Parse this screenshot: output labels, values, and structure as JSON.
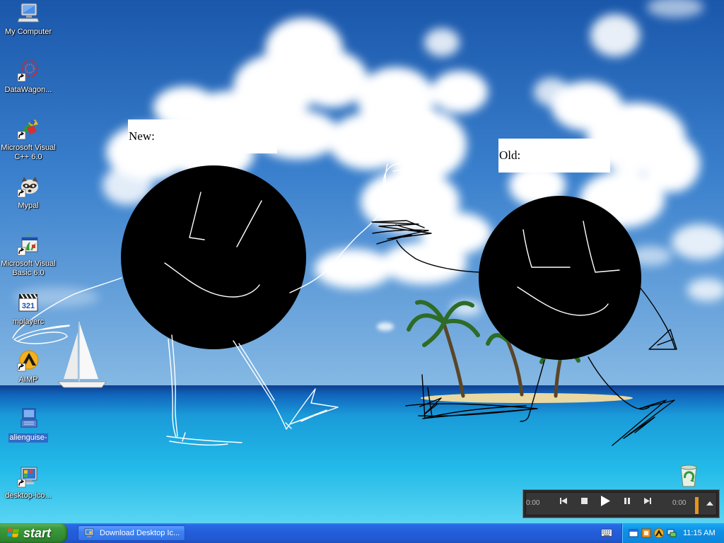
{
  "desktop": {
    "icons": [
      {
        "label": "My Computer",
        "icon": "my-computer-icon"
      },
      {
        "label": "DataWagon...",
        "icon": "datawagon-icon"
      },
      {
        "label": "Microsoft Visual C++ 6.0",
        "icon": "visual-cpp-icon"
      },
      {
        "label": "Mypal",
        "icon": "mypal-icon"
      },
      {
        "label": "Microsoft Visual Basic 6.0",
        "icon": "visual-basic-icon"
      },
      {
        "label": "mplayerc",
        "icon": "mplayerc-icon",
        "badge": "321"
      },
      {
        "label": "AIMP",
        "icon": "aimp-icon"
      },
      {
        "label": "alienguise-",
        "icon": "alienguise-icon"
      },
      {
        "label": "desktop-ico...",
        "icon": "desktop-ico-icon"
      }
    ],
    "recycle_bin": {
      "icon": "recycle-bin-icon"
    }
  },
  "drawing": {
    "new_label": "New:",
    "old_label": "Old:"
  },
  "media_player": {
    "elapsed": "0:00",
    "remaining": "0:00",
    "controls": [
      "previous-icon",
      "stop-icon",
      "play-icon",
      "pause-icon",
      "next-icon"
    ],
    "accent": "#e8931c"
  },
  "taskbar": {
    "start_label": "start",
    "tasks": [
      {
        "label": "Download Desktop Ic...",
        "icon": "browser-icon"
      }
    ],
    "tray_icons": [
      "keyboard-icon",
      "window-icon",
      "media-tray-icon",
      "aimp-tray-icon",
      "network-icon"
    ],
    "clock": "11:15 AM"
  }
}
